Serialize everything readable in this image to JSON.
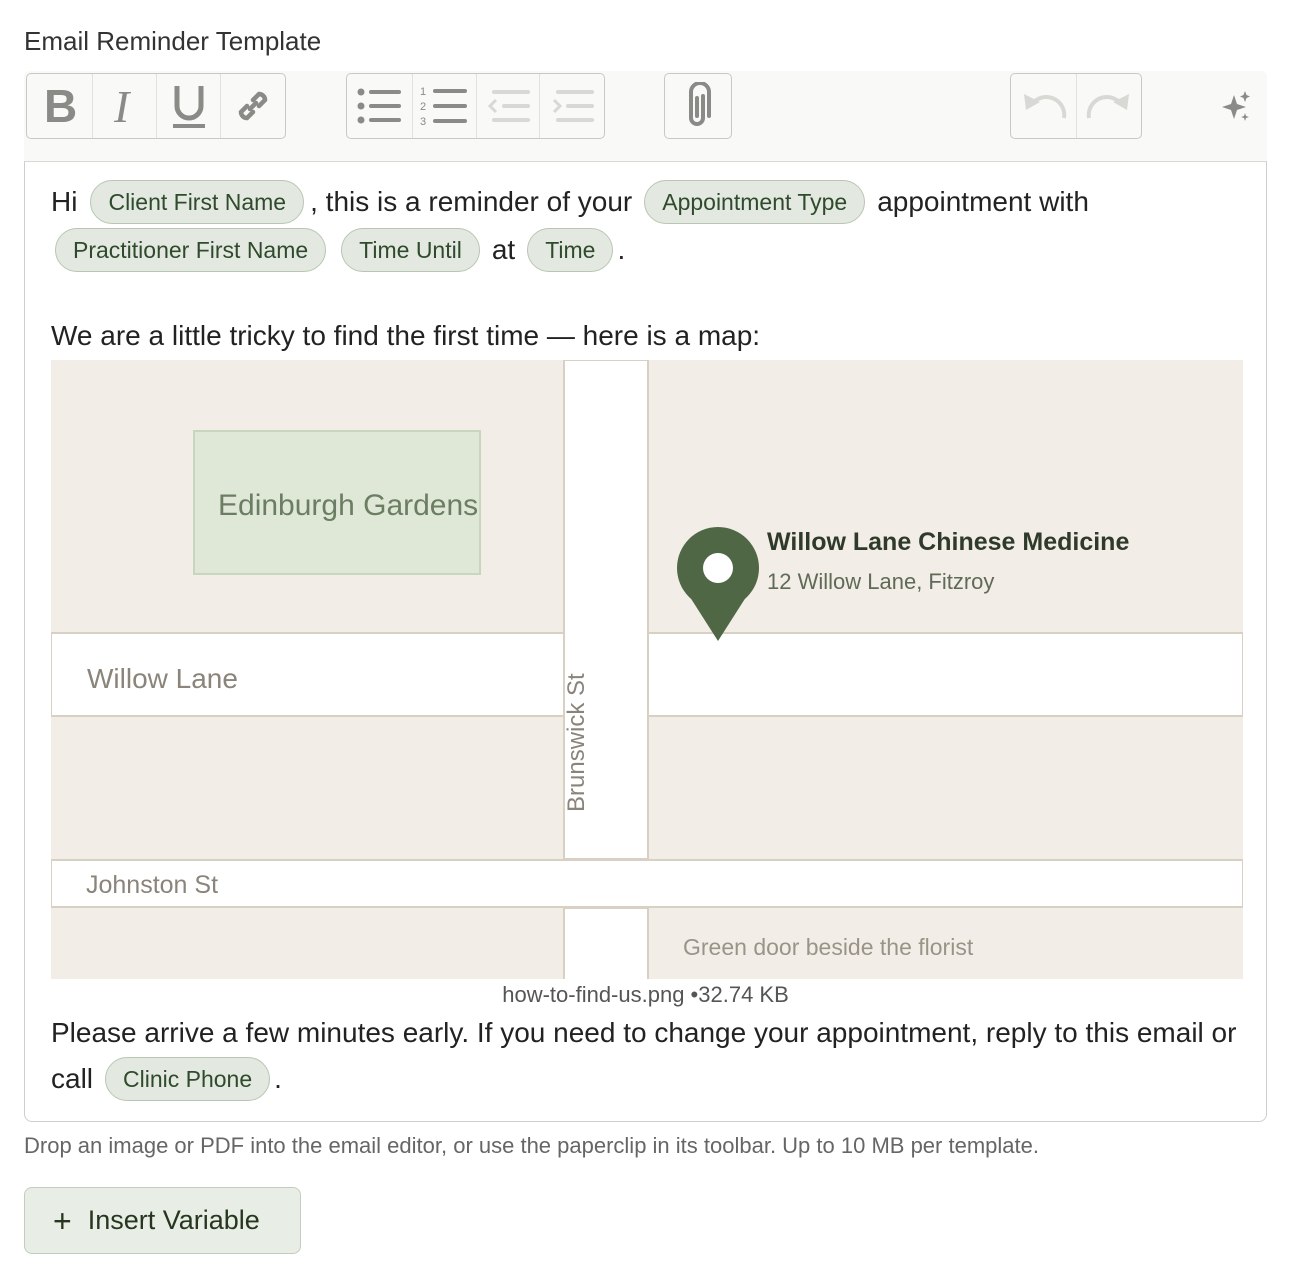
{
  "title": "Email Reminder Template",
  "toolbar": {
    "format_buttons": [
      "bold-icon",
      "italic-icon",
      "underline-icon",
      "link-icon"
    ],
    "list_buttons": [
      "bullet-list-icon",
      "numbered-list-icon",
      "outdent-icon",
      "indent-icon"
    ],
    "attach_button": "paperclip-icon",
    "history_buttons": [
      "undo-icon",
      "redo-icon"
    ],
    "ai_button": "sparkle-icon"
  },
  "body": {
    "greeting": "Hi",
    "chip_client_first_name": "Client First Name",
    "text_reminder": ", this is a reminder of your",
    "chip_appointment_type": "Appointment Type",
    "text_appointment_with": "appointment with",
    "chip_practitioner_first_name": "Practitioner First Name",
    "chip_time_until": "Time Until",
    "text_at": "at",
    "chip_time": "Time",
    "text_period": ".",
    "map_intro": "We are a little tricky to find the first time — here is a map:",
    "closing_part1": "Please arrive a few minutes early. If you need to change your appointment, reply to this email or",
    "closing_call": "call",
    "chip_clinic_phone": "Clinic Phone",
    "closing_period": "."
  },
  "map": {
    "park_label": "Edinburgh Gardens",
    "place_name": "Willow Lane Chinese Medicine",
    "place_address": "12 Willow Lane, Fitzroy",
    "street_willow": "Willow Lane",
    "street_brunswick": "Brunswick St",
    "street_johnston": "Johnston St",
    "note": "Green door beside the florist",
    "colors": {
      "land": "#f2eee7",
      "park": "#dfe8d6",
      "road": "#ffffff",
      "pin": "#4f6744"
    }
  },
  "attachment": {
    "filename": "how-to-find-us.png",
    "separator": " •",
    "size": "32.74 KB"
  },
  "helper_text": "Drop an image or PDF into the email editor, or use the paperclip in its toolbar. Up to 10 MB per template.",
  "insert_button": {
    "icon": "plus-icon",
    "label": "Insert Variable"
  }
}
